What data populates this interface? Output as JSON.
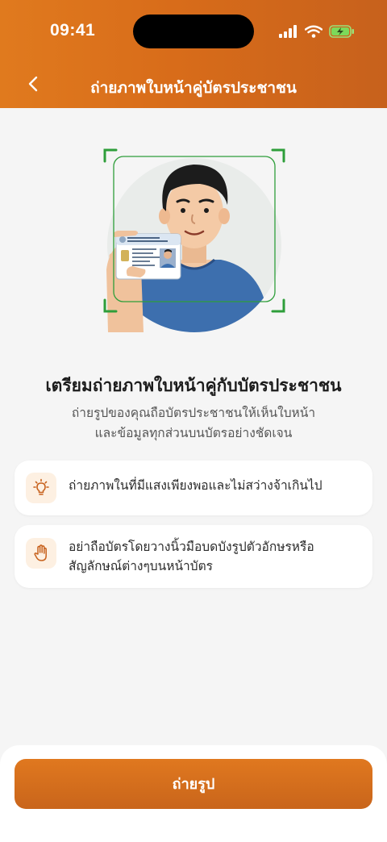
{
  "status_bar": {
    "time": "09:41"
  },
  "nav": {
    "title": "ถ่ายภาพใบหน้าคู่บัตรประชาชน"
  },
  "main": {
    "heading": "เตรียมถ่ายภาพใบหน้าคู่กับบัตรประชาชน",
    "description_line1": "ถ่ายรูปของคุณถือบัตรประชาชนให้เห็นใบหน้า",
    "description_line2": "และข้อมูลทุกส่วนบนบัตรอย่างชัดเจน"
  },
  "tips": [
    {
      "icon": "lightbulb-icon",
      "line1": "ถ่ายภาพในที่มีแสงเพียงพอและไม่สว่างจ้าเกินไป",
      "line2": ""
    },
    {
      "icon": "hand-icon",
      "line1": "อย่าถือบัตรโดยวางนิ้วมือบดบังรูปตัวอักษรหรือ",
      "line2": "สัญลักษณ์ต่างๆบนหน้าบัตร"
    }
  ],
  "action": {
    "label": "ถ่ายรูป"
  },
  "colors": {
    "brand": "#d86c1a",
    "frame": "#2e9e3a",
    "shirt": "#3d6fae"
  }
}
